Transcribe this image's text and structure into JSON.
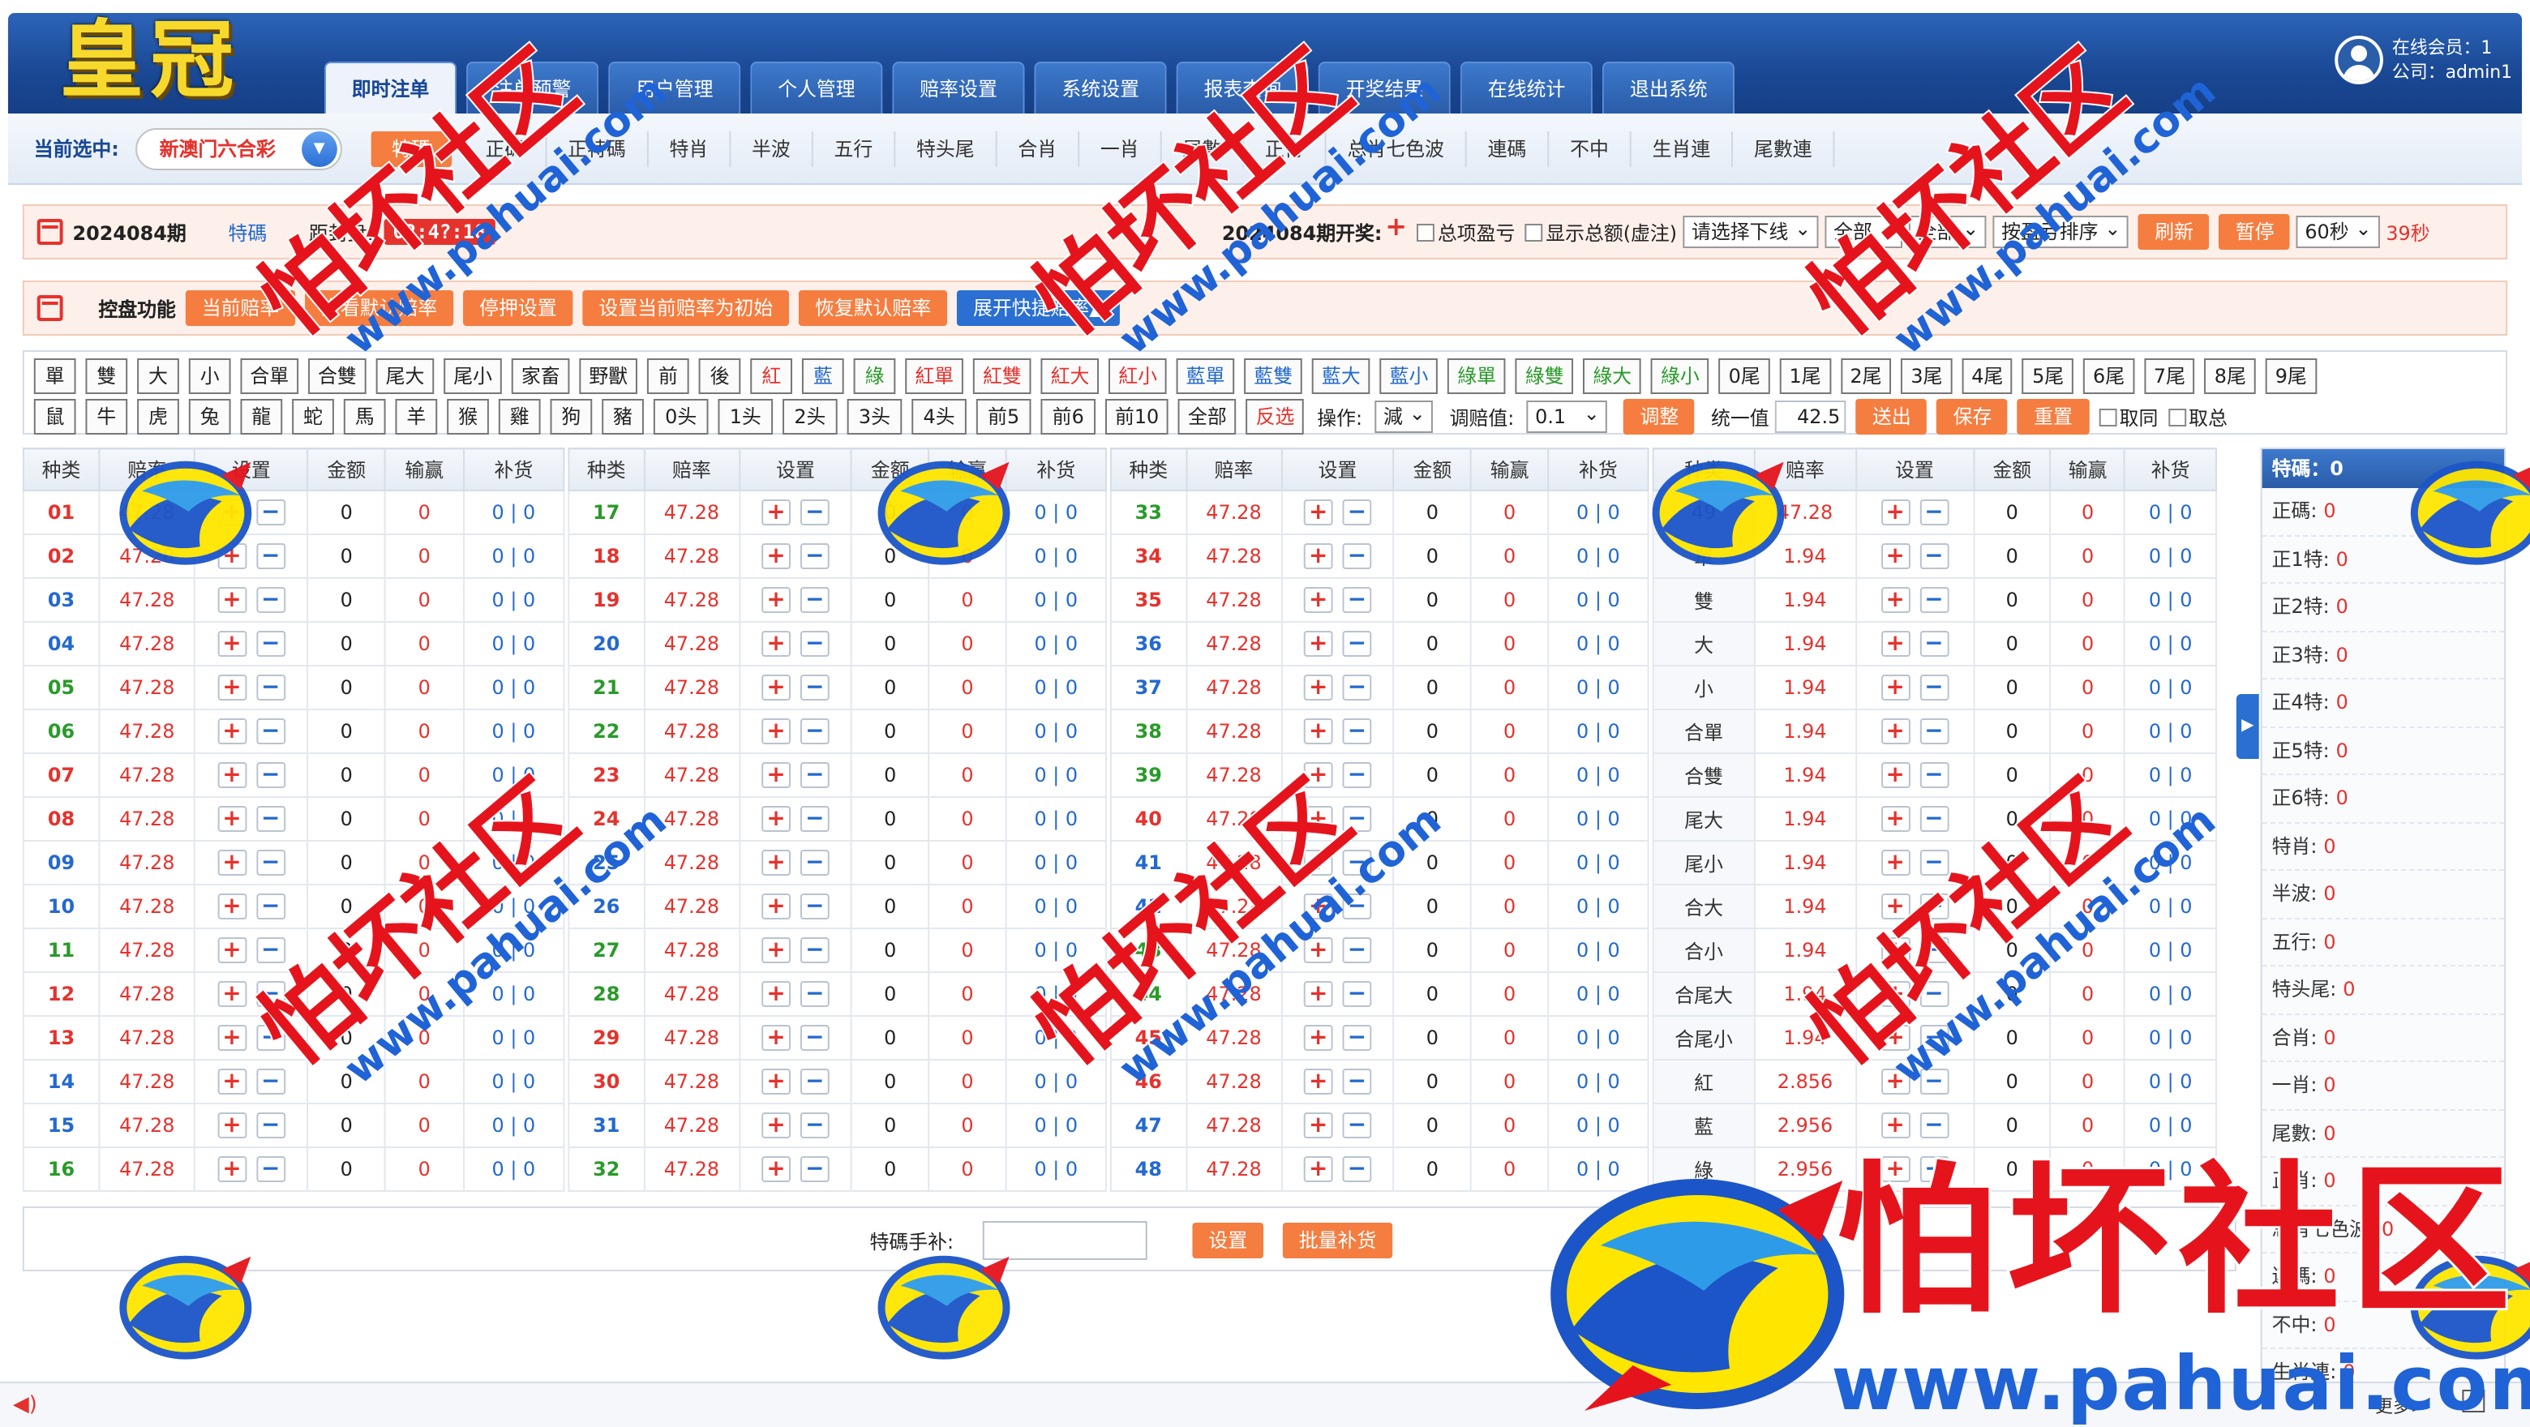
{
  "logo": "皇冠",
  "nav_tabs": [
    "即时注单",
    "注单预警",
    "用户管理",
    "个人管理",
    "赔率设置",
    "系统设置",
    "报表查询",
    "开奖结果",
    "在线统计",
    "退出系统"
  ],
  "user": {
    "online_label": "在线会员：1",
    "company_label": "公司：admin1"
  },
  "lottery": {
    "current_label": "当前选中:",
    "selected": "新澳门六合彩",
    "types": [
      "特碼",
      "正碼",
      "正特碼",
      "特肖",
      "半波",
      "五行",
      "特头尾",
      "合肖",
      "一肖",
      "尾數",
      "正肖",
      "总肖七色波",
      "連碼",
      "不中",
      "生肖連",
      "尾數連"
    ]
  },
  "period": {
    "id": "2024084期",
    "type": "特碼",
    "close_label": "距封盘:",
    "timer": "02:4?:18",
    "draw_label": "2024084期开奖:",
    "check_total_profit": "总项盈亏",
    "check_show_total": "显示总额(虚注)",
    "select_line": "请选择下线",
    "select_all1": "全部",
    "select_all2": "全部",
    "select_sort": "按盈亏排序",
    "refresh": "刷新",
    "pause": "暂停",
    "select_interval": "60秒",
    "countdown": "39秒"
  },
  "control": {
    "label": "控盘功能",
    "buttons": [
      "当前赔率",
      "查看默认赔率",
      "停押设置",
      "设置当前赔率为初始",
      "恢复默认赔率"
    ],
    "expand": "展开快捷赔率▲"
  },
  "quick_row1": [
    "單",
    "雙",
    "大",
    "小",
    "合單",
    "合雙",
    "尾大",
    "尾小",
    "家畜",
    "野獸",
    "前",
    "後",
    "紅",
    "藍",
    "綠",
    "紅單",
    "紅雙",
    "紅大",
    "紅小",
    "藍單",
    "藍雙",
    "藍大",
    "藍小",
    "綠單",
    "綠雙",
    "綠大",
    "綠小",
    "0尾",
    "1尾",
    "2尾",
    "3尾",
    "4尾",
    "5尾",
    "6尾",
    "7尾",
    "8尾",
    "9尾"
  ],
  "quick_row2": [
    "鼠",
    "牛",
    "虎",
    "兔",
    "龍",
    "蛇",
    "馬",
    "羊",
    "猴",
    "雞",
    "狗",
    "豬",
    "0头",
    "1头",
    "2头",
    "3头",
    "4头",
    "前5",
    "前6",
    "前10",
    "全部",
    "反选"
  ],
  "quick_ops": {
    "op_label": "操作:",
    "op_value": "減",
    "adj_label": "调赔值:",
    "adj_value": "0.1",
    "adjust": "调整",
    "unify_label": "统一值",
    "unify_value": "42.5",
    "send": "送出",
    "save": "保存",
    "reset": "重置",
    "take_int": "取同",
    "take_total": "取总"
  },
  "table_headers": [
    "种类",
    "赔率",
    "设置",
    "金额",
    "输赢",
    "补货"
  ],
  "number_tables": [
    [
      {
        "n": "01",
        "c": "r"
      },
      {
        "n": "02",
        "c": "r"
      },
      {
        "n": "03",
        "c": "b"
      },
      {
        "n": "04",
        "c": "b"
      },
      {
        "n": "05",
        "c": "g"
      },
      {
        "n": "06",
        "c": "g"
      },
      {
        "n": "07",
        "c": "r"
      },
      {
        "n": "08",
        "c": "r"
      },
      {
        "n": "09",
        "c": "b"
      },
      {
        "n": "10",
        "c": "b"
      },
      {
        "n": "11",
        "c": "g"
      },
      {
        "n": "12",
        "c": "r"
      },
      {
        "n": "13",
        "c": "r"
      },
      {
        "n": "14",
        "c": "b"
      },
      {
        "n": "15",
        "c": "b"
      },
      {
        "n": "16",
        "c": "g"
      }
    ],
    [
      {
        "n": "17",
        "c": "g"
      },
      {
        "n": "18",
        "c": "r"
      },
      {
        "n": "19",
        "c": "r"
      },
      {
        "n": "20",
        "c": "b"
      },
      {
        "n": "21",
        "c": "g"
      },
      {
        "n": "22",
        "c": "g"
      },
      {
        "n": "23",
        "c": "r"
      },
      {
        "n": "24",
        "c": "r"
      },
      {
        "n": "25",
        "c": "b"
      },
      {
        "n": "26",
        "c": "b"
      },
      {
        "n": "27",
        "c": "g"
      },
      {
        "n": "28",
        "c": "g"
      },
      {
        "n": "29",
        "c": "r"
      },
      {
        "n": "30",
        "c": "r"
      },
      {
        "n": "31",
        "c": "b"
      },
      {
        "n": "32",
        "c": "g"
      }
    ],
    [
      {
        "n": "33",
        "c": "g"
      },
      {
        "n": "34",
        "c": "r"
      },
      {
        "n": "35",
        "c": "r"
      },
      {
        "n": "36",
        "c": "b"
      },
      {
        "n": "37",
        "c": "b"
      },
      {
        "n": "38",
        "c": "g"
      },
      {
        "n": "39",
        "c": "g"
      },
      {
        "n": "40",
        "c": "r"
      },
      {
        "n": "41",
        "c": "b"
      },
      {
        "n": "42",
        "c": "b"
      },
      {
        "n": "43",
        "c": "g"
      },
      {
        "n": "44",
        "c": "g"
      },
      {
        "n": "45",
        "c": "r"
      },
      {
        "n": "46",
        "c": "r"
      },
      {
        "n": "47",
        "c": "b"
      },
      {
        "n": "48",
        "c": "b"
      }
    ]
  ],
  "number_odds": "47.28",
  "amount": "0",
  "winloss": "0",
  "buy": "0 | 0",
  "attr_table": [
    {
      "n": "49",
      "o": "47.28"
    },
    {
      "n": "單",
      "o": "1.94"
    },
    {
      "n": "雙",
      "o": "1.94"
    },
    {
      "n": "大",
      "o": "1.94"
    },
    {
      "n": "小",
      "o": "1.94"
    },
    {
      "n": "合單",
      "o": "1.94"
    },
    {
      "n": "合雙",
      "o": "1.94"
    },
    {
      "n": "尾大",
      "o": "1.94"
    },
    {
      "n": "尾小",
      "o": "1.94"
    },
    {
      "n": "合大",
      "o": "1.94"
    },
    {
      "n": "合小",
      "o": "1.94"
    },
    {
      "n": "合尾大",
      "o": "1.94"
    },
    {
      "n": "合尾小",
      "o": "1.94"
    },
    {
      "n": "紅",
      "o": "2.856"
    },
    {
      "n": "藍",
      "o": "2.956"
    },
    {
      "n": "綠",
      "o": "2.956"
    }
  ],
  "side": {
    "header": "特碼：0",
    "items": [
      {
        "l": "正碼:",
        "v": "0"
      },
      {
        "l": "正1特:",
        "v": "0"
      },
      {
        "l": "正2特:",
        "v": "0"
      },
      {
        "l": "正3特:",
        "v": "0"
      },
      {
        "l": "正4特:",
        "v": "0"
      },
      {
        "l": "正5特:",
        "v": "0"
      },
      {
        "l": "正6特:",
        "v": "0"
      },
      {
        "l": "特肖:",
        "v": "0"
      },
      {
        "l": "半波:",
        "v": "0"
      },
      {
        "l": "五行:",
        "v": "0"
      },
      {
        "l": "特头尾:",
        "v": "0"
      },
      {
        "l": "合肖:",
        "v": "0"
      },
      {
        "l": "一肖:",
        "v": "0"
      },
      {
        "l": "尾數:",
        "v": "0"
      },
      {
        "l": "正肖:",
        "v": "0"
      },
      {
        "l": "总肖七色波:",
        "v": "0"
      },
      {
        "l": "連碼:",
        "v": "0"
      },
      {
        "l": "不中:",
        "v": "0"
      },
      {
        "l": "生肖連:",
        "v": "0"
      }
    ]
  },
  "bottom": {
    "label": "特碼手补:",
    "set": "设置",
    "batch": "批量补货"
  },
  "footer": {
    "more": "更多>"
  },
  "watermark": {
    "cn": "怕坏社区",
    "url": "www.pahuai.com"
  },
  "colors": {
    "red": "#e5322d",
    "blue": "#2369cf",
    "green": "#2a9a2a",
    "accent": "#f57d40",
    "header": "#1a4894"
  }
}
